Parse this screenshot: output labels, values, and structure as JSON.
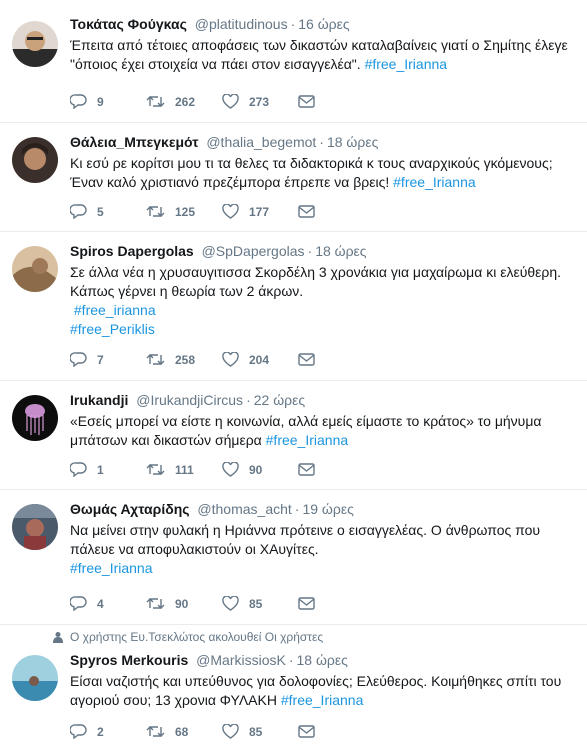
{
  "tweets": [
    {
      "name": "Τοκάτας Φούγκας",
      "handle": "@platitudinous",
      "time": "16 ώρες",
      "lines": [
        "Έπειτα από τέτοιες αποφάσεις των δικαστών καταλαβαίνεις γιατί ο Σημίτης έλεγε",
        "\"όποιος έχει στοιχεία να πάει στον εισαγγελέα\"."
      ],
      "hashtags": [
        "#free_Irianna"
      ],
      "replies": "9",
      "retweets": "262",
      "likes": "273",
      "avatar_colors": [
        "#2b2b2b",
        "#c9a27c"
      ]
    },
    {
      "name": "Θάλεια_Μπεγκεμότ",
      "handle": "@thalia_begemot",
      "time": "18 ώρες",
      "lines": [
        "Κι εσύ ρε κορίτσι μου τι τα θελες τα διδακτορικά κ τους αναρχικούς γκόμενους;",
        "Έναν καλό χριστιανό πρεζέμπορα έπρεπε να βρεις!"
      ],
      "hashtags": [
        "#free_Irianna"
      ],
      "replies": "5",
      "retweets": "125",
      "likes": "177",
      "avatar_colors": [
        "#3a2f2a",
        "#b88a6a"
      ]
    },
    {
      "name": "Spiros Dapergolas",
      "handle": "@SpDapergolas",
      "time": "18 ώρες",
      "lines": [
        "Σε άλλα νέα η χρυσαυγιτισσα Σκορδέλη 3 χρονάκια για μαχαίρωμα κι ελεύθερη.",
        "Κάπως γέρνει η θεωρία των 2 άκρων."
      ],
      "hashtags": [
        "#free_irianna",
        "#free_Periklis"
      ],
      "replies": "7",
      "retweets": "258",
      "likes": "204",
      "avatar_colors": [
        "#8b6b4a",
        "#d8c0a0"
      ]
    },
    {
      "name": "Irukandji",
      "handle": "@IrukandjiCircus",
      "time": "22 ώρες",
      "lines": [
        "«Εσείς μπορεί να είστε η κοινωνία, αλλά εμείς είμαστε το κράτος» το μήνυμα",
        "μπάτσων και δικαστών σήμερα"
      ],
      "hashtags": [
        "#free_Irianna"
      ],
      "replies": "1",
      "retweets": "111",
      "likes": "90",
      "avatar_colors": [
        "#0d0d0d",
        "#c48cc8"
      ]
    },
    {
      "name": "Θωμάς Αχταρίδης",
      "handle": "@thomas_acht",
      "time": "19 ώρες",
      "lines": [
        "Να μείνει στην φυλακή η Ηριάννα πρότεινε ο εισαγγελέας. Ο άνθρωπος που",
        "πάλευε να αποφυλακιστούν οι ΧΑυγίτες."
      ],
      "hashtags": [
        "#free_Irianna"
      ],
      "replies": "4",
      "retweets": "90",
      "likes": "85",
      "avatar_colors": [
        "#4a5a6a",
        "#a86a5a"
      ]
    },
    {
      "context": "Ο χρήστης Ευ.Τσεκλώτος ακολουθεί Οι χρήστες",
      "name": "Spyros Merkouris",
      "handle": "@MarkissiosK",
      "time": "18 ώρες",
      "lines": [
        "Είσαι ναζιστής και υπεύθυνος για δολοφονίες; Ελεύθερος.  Κοιμήθηκες σπίτι του",
        "αγοριού σου; 13 χρονια ΦΥΛΑΚΗ"
      ],
      "hashtags": [
        "#free_Irianna"
      ],
      "replies": "2",
      "retweets": "68",
      "likes": "85",
      "avatar_colors": [
        "#3b8ab0",
        "#9fd0e0"
      ]
    }
  ]
}
